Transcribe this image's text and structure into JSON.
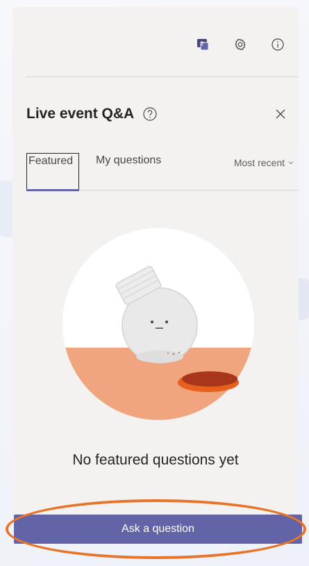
{
  "panel": {
    "title": "Live event Q&A",
    "tabs": [
      {
        "label": "Featured",
        "active": true
      },
      {
        "label": "My questions",
        "active": false
      }
    ],
    "sort": {
      "label": "Most recent"
    },
    "empty_state": "No featured questions yet",
    "ask_button_label": "Ask a question"
  },
  "icons": {
    "qa": "qa-panel-icon",
    "settings": "gear-icon",
    "info": "info-icon",
    "help": "help-icon",
    "close": "close-icon",
    "sort_chevron": "chevron-down-icon"
  },
  "colors": {
    "accent": "#6264a7",
    "highlight": "#e8742a",
    "illustration_orange": "#f0a57e",
    "lid_orange": "#e8601e"
  }
}
